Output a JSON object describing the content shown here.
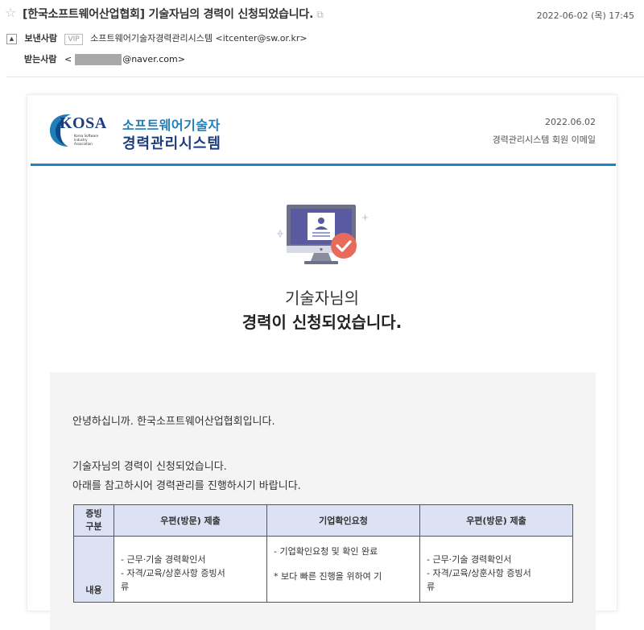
{
  "mail": {
    "subject": "[한국소프트웨어산업협회] 기술자님의 경력이 신청되었습니다.",
    "date": "2022-06-02 (목) 17:45",
    "from_label": "보낸사람",
    "vip_badge": "VIP",
    "sender": "소프트웨어기술자경력관리시스템 <itcenter@sw.or.kr>",
    "to_label": "받는사람",
    "to_prefix": "<",
    "to_email_suffix": "@naver.com>"
  },
  "brand": {
    "logo_text": "KOSA",
    "logo_sub": "Korea Software Industry Association",
    "title_line1": "소프트웨어기술자",
    "title_line2": "경력관리시스템",
    "date": "2022.06.02",
    "subtitle": "경력관리시스템 회원 이메일"
  },
  "hero": {
    "line1": "기술자님의",
    "line2": "경력이 신청되었습니다."
  },
  "body": {
    "greeting": "안녕하십니까. 한국소프트웨어산업협회입니다.",
    "line1": "기술자님의 경력이 신청되었습니다.",
    "line2": "아래를 참고하시어 경력관리를 진행하시기 바랍니다."
  },
  "table": {
    "headers": [
      "증빙\n구분",
      "우편(방문) 제출",
      "기업확인요청",
      "우편(방문) 제출"
    ],
    "row_label": "내용",
    "col1": [
      "- 근무·기술 경력확인서",
      "- 자격/교육/상훈사항 증빙서",
      "류"
    ],
    "col2": [
      "- 기업확인요청 및 확인 완료",
      "",
      "* 보다 빠른 진행을 위하여 기"
    ],
    "col3": [
      "- 근무·기술 경력확인서",
      "- 자격/교육/상훈사항 증빙서",
      "류"
    ]
  },
  "colors": {
    "brand_blue": "#1f7db8",
    "brand_navy": "#1c3e7d",
    "rule_blue": "#1b86bd",
    "monitor_purple": "#5a5aa0",
    "check_red": "#e86a5a",
    "table_header_bg": "#dce1f4"
  }
}
